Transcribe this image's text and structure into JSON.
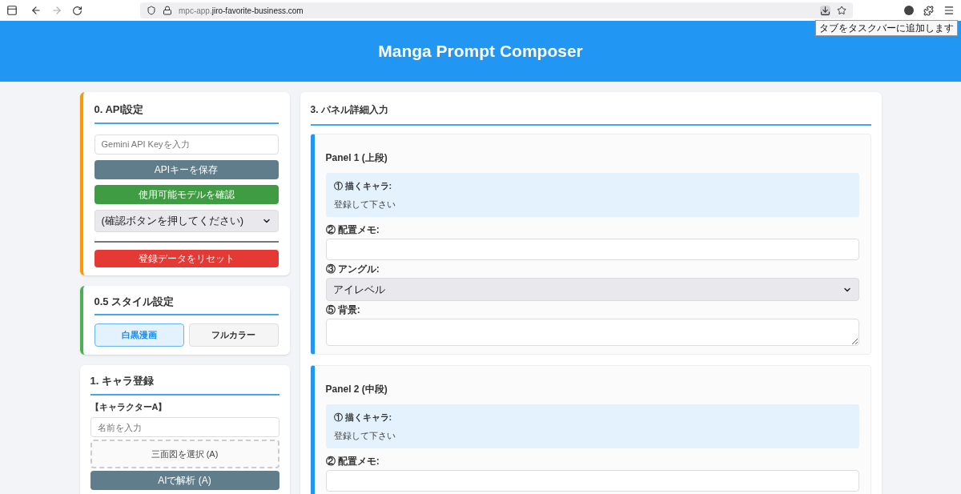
{
  "browser": {
    "url_dim": "mpc-app.",
    "url_main": "jiro-favorite-business.com",
    "tooltip": "タブをタスクバーに追加します"
  },
  "header": {
    "title": "Manga Prompt Composer"
  },
  "api_card": {
    "title": "0. API設定",
    "key_placeholder": "Gemini API Keyを入力",
    "save_button": "APIキーを保存",
    "check_button": "使用可能モデルを確認",
    "model_select": "(確認ボタンを押してください)",
    "reset_button": "登録データをリセット"
  },
  "style_card": {
    "title": "0.5 スタイル設定",
    "options": [
      {
        "label": "白黒漫画",
        "selected": true
      },
      {
        "label": "フルカラー",
        "selected": false
      }
    ]
  },
  "chara_card": {
    "title": "1. キャラ登録",
    "character_label": "【キャラクターA】",
    "name_placeholder": "名前を入力",
    "file_button": "三面図を選択 (A)",
    "analyze_button": "AIで解析 (A)"
  },
  "panels_card": {
    "title": "3. パネル詳細入力",
    "panels": [
      {
        "title": "Panel 1 (上段)",
        "character_label": "① 描くキャラ:",
        "character_note": "登録して下さい",
        "fields": [
          {
            "kind": "text",
            "label": "② 配置メモ:"
          },
          {
            "kind": "select",
            "label": "③ アングル:",
            "value": "アイレベル"
          },
          {
            "kind": "textarea",
            "label": "⑤ 背景:"
          }
        ]
      },
      {
        "title": "Panel 2 (中段)",
        "character_label": "① 描くキャラ:",
        "character_note": "登録して下さい",
        "fields": [
          {
            "kind": "text",
            "label": "② 配置メモ:"
          }
        ]
      }
    ]
  }
}
